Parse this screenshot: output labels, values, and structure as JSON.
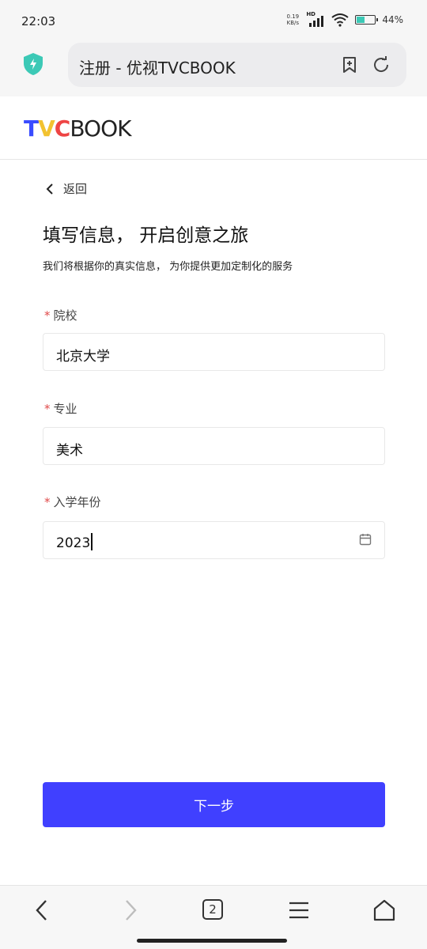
{
  "status_bar": {
    "time": "22:03",
    "network_speed": "0.19",
    "network_unit": "KB/s",
    "network_type": "HD",
    "battery_percent": "44%",
    "battery_level": 0.44
  },
  "browser": {
    "page_title": "注册 - 优视TVCBOOK",
    "tab_count": "2"
  },
  "site": {
    "logo_t": "T",
    "logo_v": "V",
    "logo_c": "C",
    "logo_rest": "BOOK"
  },
  "form": {
    "back_label": "返回",
    "title": "填写信息， 开启创意之旅",
    "subtitle": "我们将根据你的真实信息， 为你提供更加定制化的服务",
    "required_mark": "*",
    "fields": [
      {
        "label": "院校",
        "value": "北京大学"
      },
      {
        "label": "专业",
        "value": "美术"
      },
      {
        "label": "入学年份",
        "value": "2023"
      }
    ],
    "next_button": "下一步"
  },
  "colors": {
    "primary": "#4040ff",
    "required": "#e04a4a",
    "shield": "#3cc9b6"
  }
}
